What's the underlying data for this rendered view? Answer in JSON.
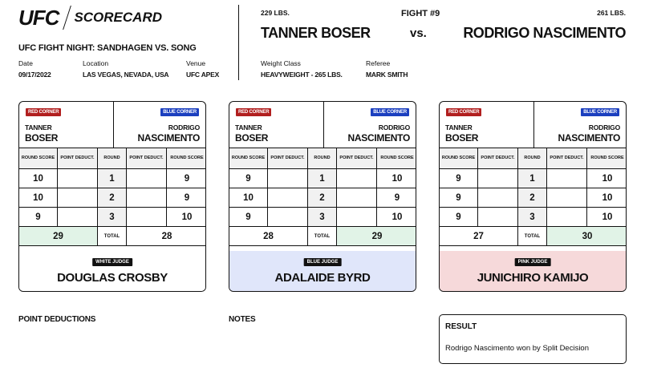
{
  "header": {
    "brand": "UFC",
    "doc_title": "SCORECARD",
    "event_title": "UFC FIGHT NIGHT: SANDHAGEN VS. SONG",
    "meta": [
      {
        "label": "Date",
        "value": "09/17/2022"
      },
      {
        "label": "Location",
        "value": "LAS VEGAS, NEVADA, USA"
      },
      {
        "label": "Venue",
        "value": "UFC APEX"
      }
    ]
  },
  "fight": {
    "number": "FIGHT #9",
    "vs": "vs.",
    "red": {
      "weight": "229 LBS.",
      "name": "TANNER BOSER",
      "first": "TANNER",
      "last": "BOSER"
    },
    "blue": {
      "weight": "261 LBS.",
      "name": "RODRIGO NASCIMENTO",
      "first": "RODRIGO",
      "last": "NASCIMENTO"
    },
    "weight_class_label": "Weight Class",
    "weight_class": "HEAVYWEIGHT - 265 LBS.",
    "referee_label": "Referee",
    "referee": "MARK SMITH"
  },
  "labels": {
    "red_corner": "RED CORNER",
    "blue_corner": "BLUE CORNER",
    "round_score": "ROUND SCORE",
    "point_deduct": "POINT DEDUCT.",
    "round": "ROUND",
    "total": "TOTAL"
  },
  "cards": [
    {
      "judge_badge": "WHITE JUDGE",
      "judge_name": "DOUGLAS CROSBY",
      "judge_color": "#ffffff",
      "rounds": [
        {
          "round": "1",
          "red": "10",
          "red_ded": "",
          "blue_ded": "",
          "blue": "9"
        },
        {
          "round": "2",
          "red": "10",
          "red_ded": "",
          "blue_ded": "",
          "blue": "9"
        },
        {
          "round": "3",
          "red": "9",
          "red_ded": "",
          "blue_ded": "",
          "blue": "10"
        }
      ],
      "red_total": "29",
      "blue_total": "28",
      "winner": "red"
    },
    {
      "judge_badge": "BLUE JUDGE",
      "judge_name": "ADALAIDE BYRD",
      "judge_color": "#e0e6fa",
      "rounds": [
        {
          "round": "1",
          "red": "9",
          "red_ded": "",
          "blue_ded": "",
          "blue": "10"
        },
        {
          "round": "2",
          "red": "10",
          "red_ded": "",
          "blue_ded": "",
          "blue": "9"
        },
        {
          "round": "3",
          "red": "9",
          "red_ded": "",
          "blue_ded": "",
          "blue": "10"
        }
      ],
      "red_total": "28",
      "blue_total": "29",
      "winner": "blue"
    },
    {
      "judge_badge": "PINK JUDGE",
      "judge_name": "JUNICHIRO KAMIJO",
      "judge_color": "#f6d9da",
      "rounds": [
        {
          "round": "1",
          "red": "9",
          "red_ded": "",
          "blue_ded": "",
          "blue": "10"
        },
        {
          "round": "2",
          "red": "9",
          "red_ded": "",
          "blue_ded": "",
          "blue": "10"
        },
        {
          "round": "3",
          "red": "9",
          "red_ded": "",
          "blue_ded": "",
          "blue": "10"
        }
      ],
      "red_total": "27",
      "blue_total": "30",
      "winner": "blue"
    }
  ],
  "footer": {
    "point_deductions_title": "POINT DEDUCTIONS",
    "notes_title": "NOTES",
    "result_title": "RESULT",
    "result_text": "Rodrigo Nascimento won by Split Decision"
  },
  "colors": {
    "red_corner": "#b11f1f",
    "blue_corner": "#1b3fbf",
    "winner_fill": "#e1f3e7"
  }
}
